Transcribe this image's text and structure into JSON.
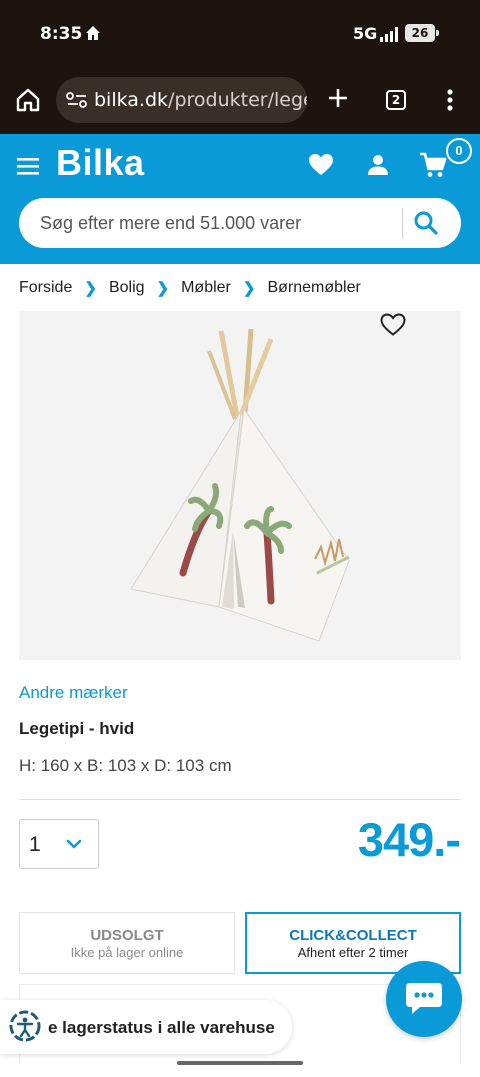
{
  "status_bar": {
    "time": "8:35",
    "network": "5G",
    "battery": "26"
  },
  "browser": {
    "url_domain": "bilka.dk",
    "url_path": "/produkter/legeti",
    "tab_count": "2"
  },
  "header": {
    "logo": "Bilka",
    "cart_count": "0",
    "search_placeholder": "Søg efter mere end 51.000 varer"
  },
  "breadcrumb": [
    "Forside",
    "Bolig",
    "Møbler",
    "Børnemøbler"
  ],
  "product": {
    "brand": "Andre mærker",
    "title": "Legetipi - hvid",
    "dimensions": "H: 160 x B: 103 x D: 103 cm",
    "quantity": "1",
    "price": "349.-"
  },
  "delivery": {
    "online_title": "UDSOLGT",
    "online_sub": "Ikke på lager online",
    "cc_title": "CLICK&COLLECT",
    "cc_sub": "Afhent efter 2 timer"
  },
  "stock": {
    "label": "e lagerstatus i alle varehuse"
  },
  "colors": {
    "brand_blue": "#0a9ad7",
    "dark_bar": "#1d1410"
  }
}
